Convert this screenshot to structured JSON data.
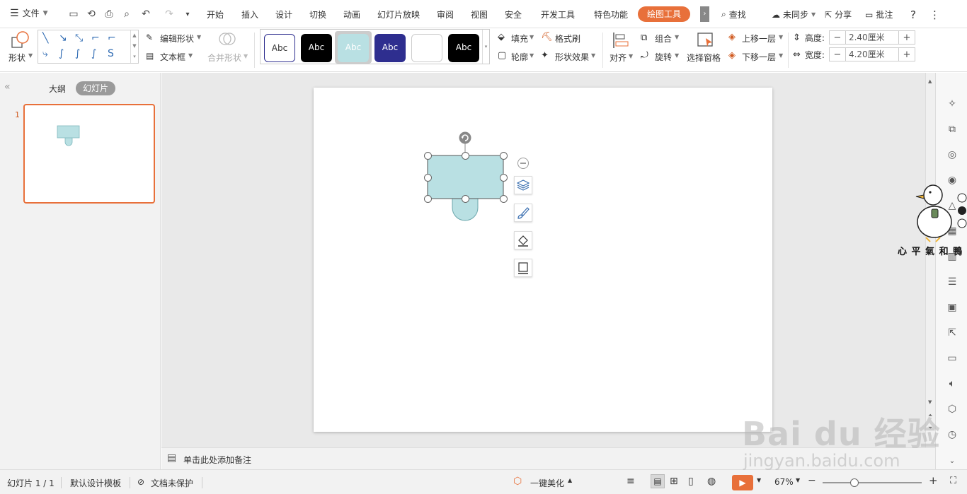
{
  "menu": {
    "file_label": "文件",
    "tabs": [
      "开始",
      "插入",
      "设计",
      "切换",
      "动画",
      "幻灯片放映",
      "审阅",
      "视图",
      "安全",
      "开发工具",
      "特色功能"
    ],
    "active_tab": "绘图工具",
    "right": {
      "search": "查找",
      "sync": "未同步",
      "share": "分享",
      "comment": "批注",
      "help": "?"
    }
  },
  "ribbon": {
    "shape_label": "形状",
    "edit_shape": "编辑形状",
    "text_box": "文本框",
    "merge_shape": "合并形状",
    "style_sample": "Abc",
    "fill": "填充",
    "format_painter": "格式刷",
    "outline": "轮廓",
    "shape_effect": "形状效果",
    "align": "对齐",
    "group": "组合",
    "rotate": "旋转",
    "selection_pane": "选择窗格",
    "bring_forward": "上移一层",
    "send_backward": "下移一层",
    "height_label": "高度:",
    "height_value": "2.40厘米",
    "width_label": "宽度:",
    "width_value": "4.20厘米",
    "colors": {
      "accent": "#e8703a",
      "shape_fill": "#b9e0e3",
      "navy": "#2e2e8f"
    }
  },
  "left_panel": {
    "outline_tab": "大纲",
    "slides_tab": "幻灯片",
    "slide_number": "1"
  },
  "notes": {
    "placeholder": "单击此处添加备注"
  },
  "status": {
    "slide_counter": "幻灯片 1 / 1",
    "template": "默认设计模板",
    "protection": "文档未保护",
    "beautify": "一键美化",
    "zoom": "67%"
  },
  "watermark": {
    "brand": "Bai du 经验",
    "url": "jingyan.baidu.com",
    "duck_caption": "心 平 氣 和 鴨"
  }
}
